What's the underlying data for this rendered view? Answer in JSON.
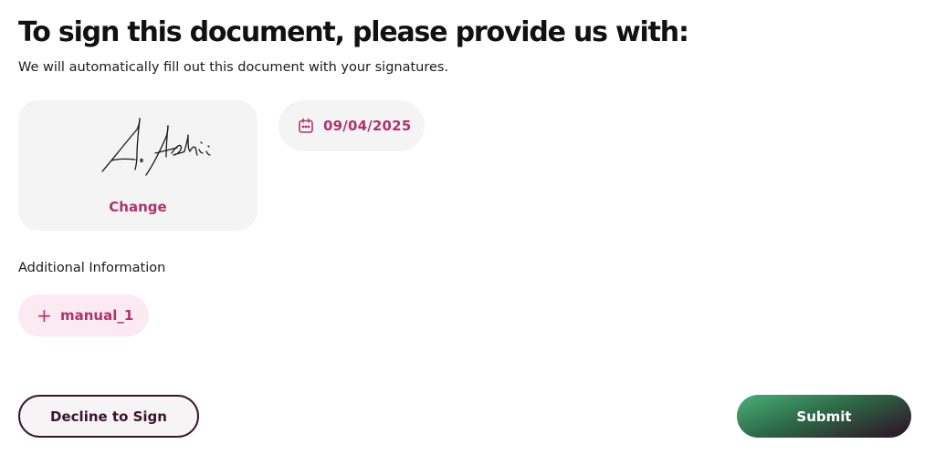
{
  "header": {
    "title": "To sign this document, please provide us with:",
    "subtitle": "We will automatically fill out this document with your signatures."
  },
  "signature": {
    "change_label": "Change"
  },
  "date_field": {
    "icon": "calendar-icon",
    "value": "09/04/2025"
  },
  "additional_info": {
    "label": "Additional Information",
    "fields": [
      {
        "icon": "plus-icon",
        "label": "manual_1"
      }
    ]
  },
  "actions": {
    "decline_label": "Decline to Sign",
    "submit_label": "Submit"
  },
  "colors": {
    "accent": "#b1326d",
    "pill_background": "#f4f4f4",
    "manual_pill_background": "#fbeaf1",
    "decline_border": "#3a1530",
    "submit_gradient_start": "#4ab07a",
    "submit_gradient_end": "#2f1e2b"
  }
}
